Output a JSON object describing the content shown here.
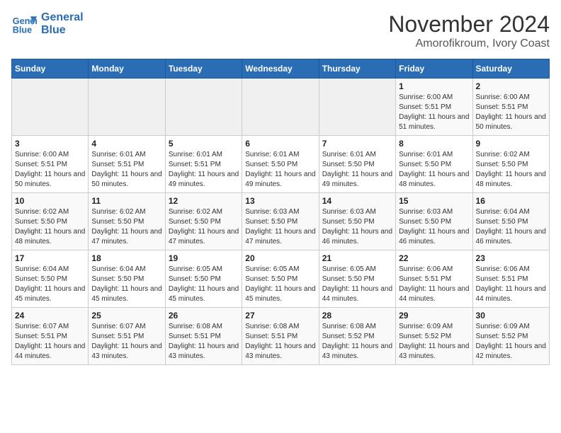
{
  "header": {
    "logo_line1": "General",
    "logo_line2": "Blue",
    "title": "November 2024",
    "subtitle": "Amorofikroum, Ivory Coast"
  },
  "weekdays": [
    "Sunday",
    "Monday",
    "Tuesday",
    "Wednesday",
    "Thursday",
    "Friday",
    "Saturday"
  ],
  "weeks": [
    [
      {
        "day": "",
        "empty": true
      },
      {
        "day": "",
        "empty": true
      },
      {
        "day": "",
        "empty": true
      },
      {
        "day": "",
        "empty": true
      },
      {
        "day": "",
        "empty": true
      },
      {
        "day": "1",
        "sunrise": "Sunrise: 6:00 AM",
        "sunset": "Sunset: 5:51 PM",
        "daylight": "Daylight: 11 hours and 51 minutes."
      },
      {
        "day": "2",
        "sunrise": "Sunrise: 6:00 AM",
        "sunset": "Sunset: 5:51 PM",
        "daylight": "Daylight: 11 hours and 50 minutes."
      }
    ],
    [
      {
        "day": "3",
        "sunrise": "Sunrise: 6:00 AM",
        "sunset": "Sunset: 5:51 PM",
        "daylight": "Daylight: 11 hours and 50 minutes."
      },
      {
        "day": "4",
        "sunrise": "Sunrise: 6:01 AM",
        "sunset": "Sunset: 5:51 PM",
        "daylight": "Daylight: 11 hours and 50 minutes."
      },
      {
        "day": "5",
        "sunrise": "Sunrise: 6:01 AM",
        "sunset": "Sunset: 5:51 PM",
        "daylight": "Daylight: 11 hours and 49 minutes."
      },
      {
        "day": "6",
        "sunrise": "Sunrise: 6:01 AM",
        "sunset": "Sunset: 5:50 PM",
        "daylight": "Daylight: 11 hours and 49 minutes."
      },
      {
        "day": "7",
        "sunrise": "Sunrise: 6:01 AM",
        "sunset": "Sunset: 5:50 PM",
        "daylight": "Daylight: 11 hours and 49 minutes."
      },
      {
        "day": "8",
        "sunrise": "Sunrise: 6:01 AM",
        "sunset": "Sunset: 5:50 PM",
        "daylight": "Daylight: 11 hours and 48 minutes."
      },
      {
        "day": "9",
        "sunrise": "Sunrise: 6:02 AM",
        "sunset": "Sunset: 5:50 PM",
        "daylight": "Daylight: 11 hours and 48 minutes."
      }
    ],
    [
      {
        "day": "10",
        "sunrise": "Sunrise: 6:02 AM",
        "sunset": "Sunset: 5:50 PM",
        "daylight": "Daylight: 11 hours and 48 minutes."
      },
      {
        "day": "11",
        "sunrise": "Sunrise: 6:02 AM",
        "sunset": "Sunset: 5:50 PM",
        "daylight": "Daylight: 11 hours and 47 minutes."
      },
      {
        "day": "12",
        "sunrise": "Sunrise: 6:02 AM",
        "sunset": "Sunset: 5:50 PM",
        "daylight": "Daylight: 11 hours and 47 minutes."
      },
      {
        "day": "13",
        "sunrise": "Sunrise: 6:03 AM",
        "sunset": "Sunset: 5:50 PM",
        "daylight": "Daylight: 11 hours and 47 minutes."
      },
      {
        "day": "14",
        "sunrise": "Sunrise: 6:03 AM",
        "sunset": "Sunset: 5:50 PM",
        "daylight": "Daylight: 11 hours and 46 minutes."
      },
      {
        "day": "15",
        "sunrise": "Sunrise: 6:03 AM",
        "sunset": "Sunset: 5:50 PM",
        "daylight": "Daylight: 11 hours and 46 minutes."
      },
      {
        "day": "16",
        "sunrise": "Sunrise: 6:04 AM",
        "sunset": "Sunset: 5:50 PM",
        "daylight": "Daylight: 11 hours and 46 minutes."
      }
    ],
    [
      {
        "day": "17",
        "sunrise": "Sunrise: 6:04 AM",
        "sunset": "Sunset: 5:50 PM",
        "daylight": "Daylight: 11 hours and 45 minutes."
      },
      {
        "day": "18",
        "sunrise": "Sunrise: 6:04 AM",
        "sunset": "Sunset: 5:50 PM",
        "daylight": "Daylight: 11 hours and 45 minutes."
      },
      {
        "day": "19",
        "sunrise": "Sunrise: 6:05 AM",
        "sunset": "Sunset: 5:50 PM",
        "daylight": "Daylight: 11 hours and 45 minutes."
      },
      {
        "day": "20",
        "sunrise": "Sunrise: 6:05 AM",
        "sunset": "Sunset: 5:50 PM",
        "daylight": "Daylight: 11 hours and 45 minutes."
      },
      {
        "day": "21",
        "sunrise": "Sunrise: 6:05 AM",
        "sunset": "Sunset: 5:50 PM",
        "daylight": "Daylight: 11 hours and 44 minutes."
      },
      {
        "day": "22",
        "sunrise": "Sunrise: 6:06 AM",
        "sunset": "Sunset: 5:51 PM",
        "daylight": "Daylight: 11 hours and 44 minutes."
      },
      {
        "day": "23",
        "sunrise": "Sunrise: 6:06 AM",
        "sunset": "Sunset: 5:51 PM",
        "daylight": "Daylight: 11 hours and 44 minutes."
      }
    ],
    [
      {
        "day": "24",
        "sunrise": "Sunrise: 6:07 AM",
        "sunset": "Sunset: 5:51 PM",
        "daylight": "Daylight: 11 hours and 44 minutes."
      },
      {
        "day": "25",
        "sunrise": "Sunrise: 6:07 AM",
        "sunset": "Sunset: 5:51 PM",
        "daylight": "Daylight: 11 hours and 43 minutes."
      },
      {
        "day": "26",
        "sunrise": "Sunrise: 6:08 AM",
        "sunset": "Sunset: 5:51 PM",
        "daylight": "Daylight: 11 hours and 43 minutes."
      },
      {
        "day": "27",
        "sunrise": "Sunrise: 6:08 AM",
        "sunset": "Sunset: 5:51 PM",
        "daylight": "Daylight: 11 hours and 43 minutes."
      },
      {
        "day": "28",
        "sunrise": "Sunrise: 6:08 AM",
        "sunset": "Sunset: 5:52 PM",
        "daylight": "Daylight: 11 hours and 43 minutes."
      },
      {
        "day": "29",
        "sunrise": "Sunrise: 6:09 AM",
        "sunset": "Sunset: 5:52 PM",
        "daylight": "Daylight: 11 hours and 43 minutes."
      },
      {
        "day": "30",
        "sunrise": "Sunrise: 6:09 AM",
        "sunset": "Sunset: 5:52 PM",
        "daylight": "Daylight: 11 hours and 42 minutes."
      }
    ]
  ]
}
